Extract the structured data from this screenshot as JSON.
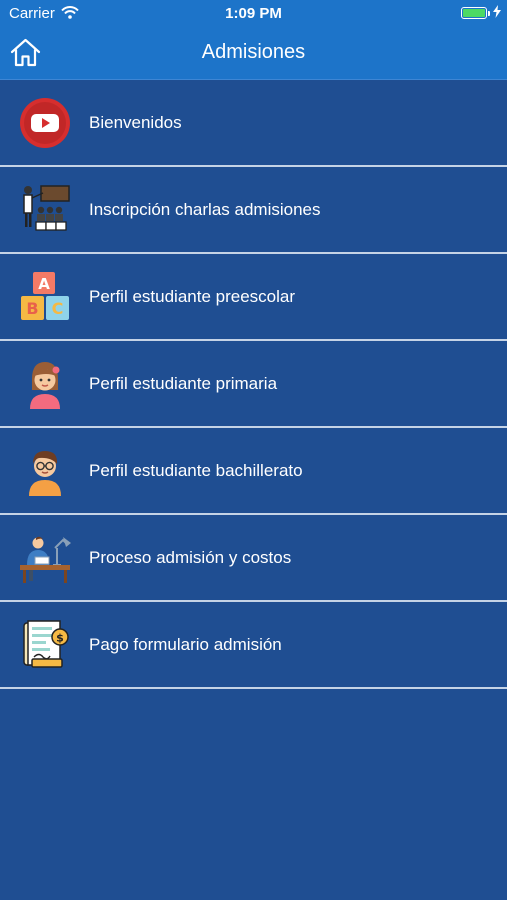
{
  "status_bar": {
    "carrier": "Carrier",
    "time": "1:09 PM",
    "wifi_icon": "wifi-icon",
    "battery_icon": "battery-icon",
    "battery_color": "#4cd964"
  },
  "nav_bar": {
    "title": "Admisiones",
    "home_icon": "home-icon",
    "background": "#1d74c9"
  },
  "menu": {
    "items": [
      {
        "label": "Bienvenidos",
        "icon": "youtube-play-icon"
      },
      {
        "label": "Inscripción charlas admisiones",
        "icon": "presentation-audience-icon"
      },
      {
        "label": "Perfil estudiante preescolar",
        "icon": "abc-blocks-icon"
      },
      {
        "label": "Perfil estudiante primaria",
        "icon": "girl-student-icon"
      },
      {
        "label": "Perfil estudiante bachillerato",
        "icon": "boy-student-icon"
      },
      {
        "label": "Proceso admisión y costos",
        "icon": "desk-study-icon"
      },
      {
        "label": "Pago formulario admisión",
        "icon": "payment-form-icon"
      }
    ]
  },
  "colors": {
    "background": "#1f4e92",
    "divider": "#c5d3e6"
  }
}
